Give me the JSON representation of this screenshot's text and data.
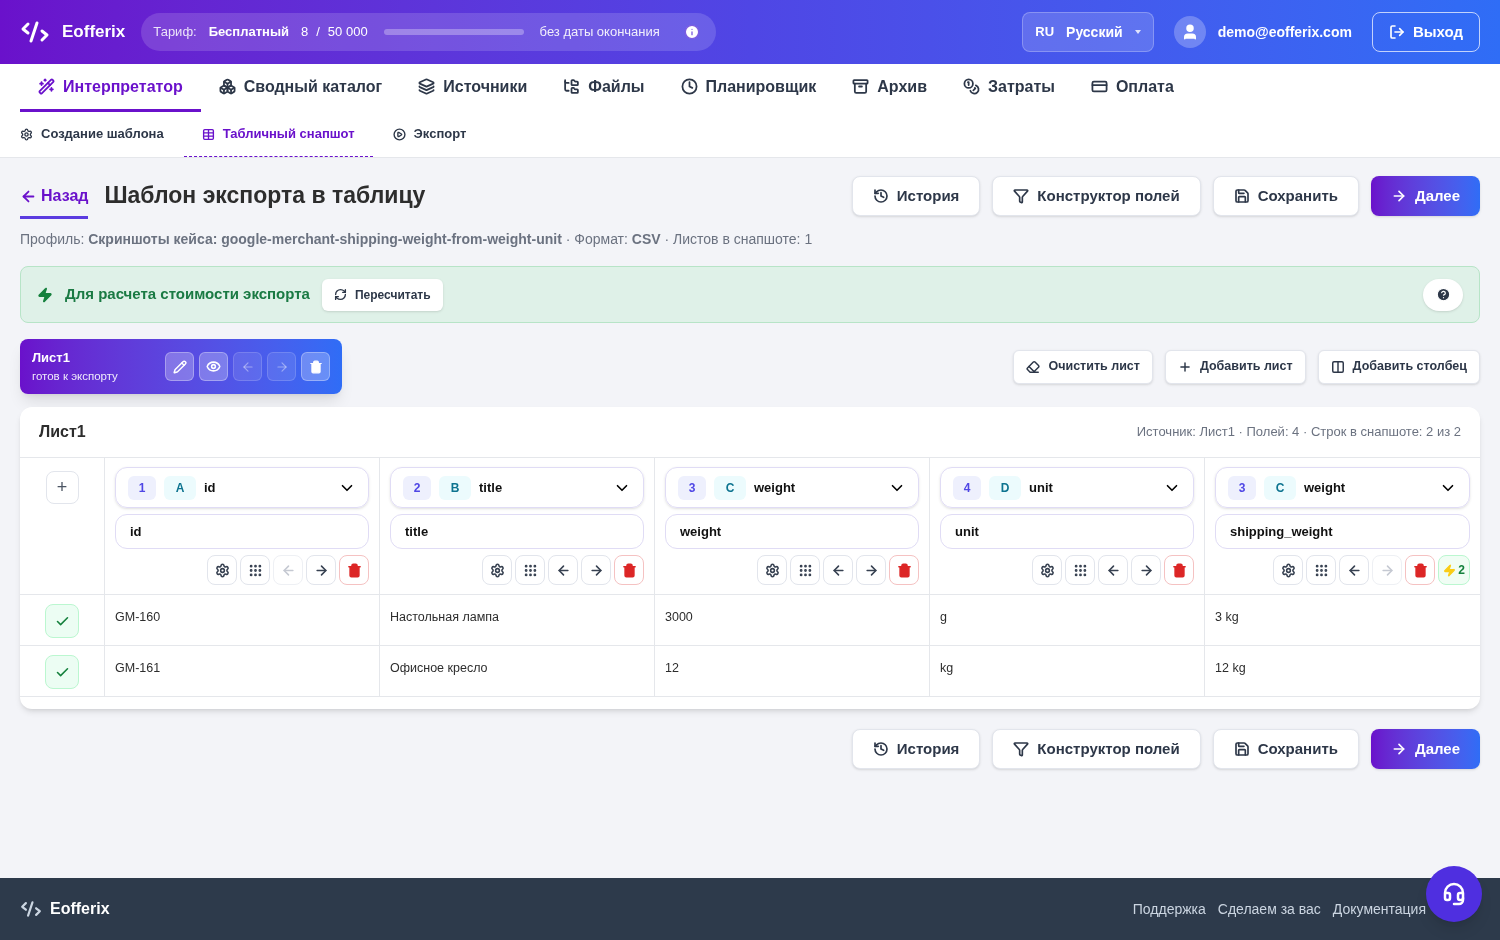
{
  "header": {
    "brand": "Eofferix",
    "plan": {
      "label": "Тариф:",
      "name": "Бесплатный",
      "used": "8",
      "separator": "/",
      "limit": "50 000",
      "level": 0.0002,
      "expiry": "без даты окончания"
    },
    "language": {
      "code": "RU",
      "name": "Русский"
    },
    "user_email": "demo@eofferix.com",
    "logout": "Выход"
  },
  "nav_tabs": [
    {
      "label": "Интерпретатор",
      "selected": true
    },
    {
      "label": "Сводный каталог",
      "selected": false
    },
    {
      "label": "Источники",
      "selected": false
    },
    {
      "label": "Файлы",
      "selected": false
    },
    {
      "label": "Планировщик",
      "selected": false
    },
    {
      "label": "Архив",
      "selected": false
    },
    {
      "label": "Затраты",
      "selected": false
    },
    {
      "label": "Оплата",
      "selected": false
    }
  ],
  "sub_tabs": [
    {
      "label": "Создание шаблона",
      "selected": false
    },
    {
      "label": "Табличный снапшот",
      "selected": true
    },
    {
      "label": "Экспорт",
      "selected": false
    }
  ],
  "page": {
    "back": "Назад",
    "title": "Шаблон экспорта в таблицу",
    "profile_line": "Профиль: **Скриншоты кейса: google-merchant-shipping-weight-from-weight-unit** · Формат: **CSV** · Листов в снапшоте: 1"
  },
  "top_actions": [
    {
      "label": "История",
      "kind": "secondary"
    },
    {
      "label": "Конструктор полей",
      "kind": "secondary"
    },
    {
      "label": "Сохранить",
      "kind": "secondary"
    },
    {
      "label": "Далее",
      "kind": "primary"
    }
  ],
  "cost_banner": {
    "text": "Для расчета стоимости экспорта",
    "button": "Пересчитать"
  },
  "sheets": [
    {
      "name": "Лист1",
      "status": "готов к экспорту",
      "selected": true,
      "move_left_disabled": true,
      "move_right_disabled": true
    }
  ],
  "sheet_actions": [
    "Очистить лист",
    "Добавить лист",
    "Добавить столбец"
  ],
  "table": {
    "title": "Лист1",
    "meta": "Источник: Лист1 · Полей: 4 · Строк в снапшоте: 2 из 2",
    "add_symbol": "+",
    "columns": [
      {
        "index": "1",
        "letter": "A",
        "source": "id",
        "name": "id",
        "move_left_disabled": true,
        "move_right_disabled": false
      },
      {
        "index": "2",
        "letter": "B",
        "source": "title",
        "name": "title",
        "move_left_disabled": false,
        "move_right_disabled": false
      },
      {
        "index": "3",
        "letter": "C",
        "source": "weight",
        "name": "weight",
        "move_left_disabled": false,
        "move_right_disabled": false
      },
      {
        "index": "4",
        "letter": "D",
        "source": "unit",
        "name": "unit",
        "move_left_disabled": false,
        "move_right_disabled": false
      },
      {
        "index": "3",
        "letter": "C",
        "source": "weight",
        "name": "shipping_weight",
        "move_left_disabled": false,
        "move_right_disabled": true,
        "rule_count": "2"
      }
    ],
    "rows": [
      {
        "checked": true,
        "cells": [
          "GM-160",
          "Настольная лампа",
          "3000",
          "g",
          "3 kg"
        ]
      },
      {
        "checked": true,
        "cells": [
          "GM-161",
          "Офисное кресло",
          "12",
          "kg",
          "12 kg"
        ]
      }
    ]
  },
  "bottom_actions": [
    {
      "label": "История",
      "kind": "secondary"
    },
    {
      "label": "Конструктор полей",
      "kind": "secondary"
    },
    {
      "label": "Сохранить",
      "kind": "secondary"
    },
    {
      "label": "Далее",
      "kind": "primary"
    }
  ],
  "footer": {
    "brand": "Eofferix",
    "links": [
      "Поддержка",
      "Сделаем за вас",
      "Документация"
    ]
  }
}
